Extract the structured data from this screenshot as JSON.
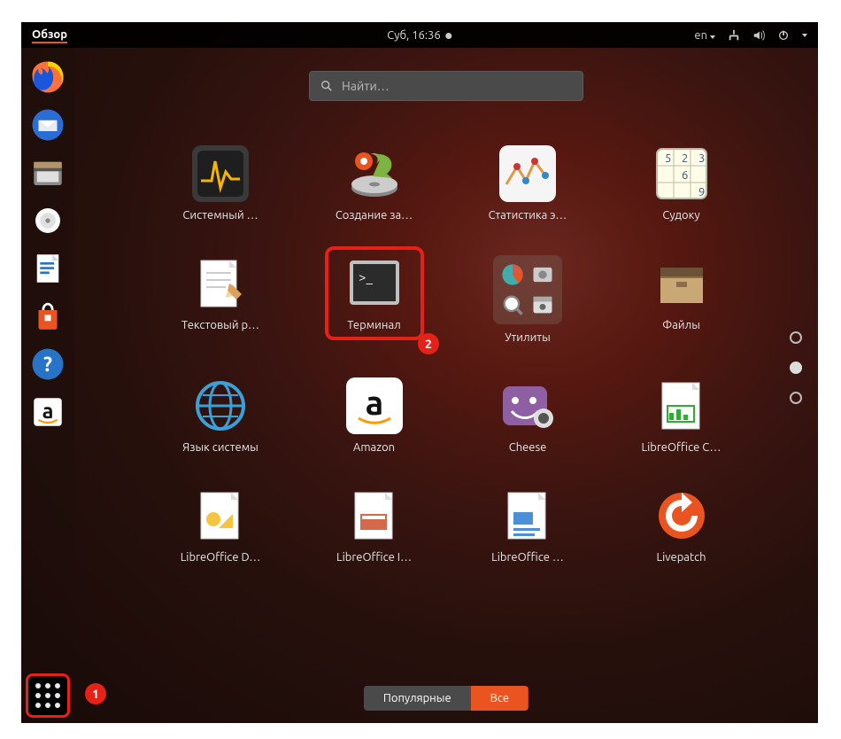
{
  "topbar": {
    "activities": "Обзор",
    "datetime": "Суб, 16:36",
    "lang": "en"
  },
  "search": {
    "placeholder": "Найти…"
  },
  "dock": [
    {
      "name": "firefox"
    },
    {
      "name": "thunderbird"
    },
    {
      "name": "files"
    },
    {
      "name": "rhythmbox"
    },
    {
      "name": "libreoffice-writer"
    },
    {
      "name": "software"
    },
    {
      "name": "help"
    },
    {
      "name": "amazon"
    }
  ],
  "apps": [
    {
      "name": "system-monitor",
      "label": "Системный …"
    },
    {
      "name": "startup-disk",
      "label": "Создание за…"
    },
    {
      "name": "power-stats",
      "label": "Статистика э…"
    },
    {
      "name": "sudoku",
      "label": "Судоку"
    },
    {
      "name": "text-editor",
      "label": "Текстовый р…"
    },
    {
      "name": "terminal",
      "label": "Терминал",
      "highlight": true
    },
    {
      "name": "utilities",
      "label": "Утилиты",
      "folder": true
    },
    {
      "name": "archive",
      "label": "Файлы"
    },
    {
      "name": "language",
      "label": "Язык системы"
    },
    {
      "name": "amazon",
      "label": "Amazon"
    },
    {
      "name": "cheese",
      "label": "Cheese"
    },
    {
      "name": "libreoffice-calc",
      "label": "LibreOffice C…"
    },
    {
      "name": "libreoffice-draw",
      "label": "LibreOffice D…"
    },
    {
      "name": "libreoffice-impress",
      "label": "LibreOffice I…"
    },
    {
      "name": "libreoffice-writer",
      "label": "LibreOffice …"
    },
    {
      "name": "livepatch",
      "label": "Livepatch"
    }
  ],
  "tabs": {
    "frequent": "Популярные",
    "all": "Все",
    "active": "all"
  },
  "annotations": {
    "show_apps": "1",
    "terminal": "2"
  },
  "pagers": {
    "count": 3,
    "active": 1
  }
}
